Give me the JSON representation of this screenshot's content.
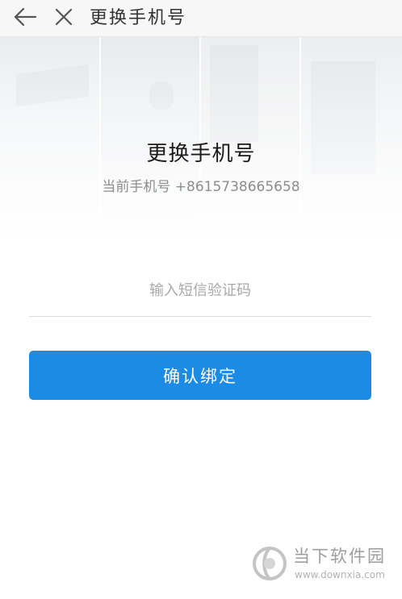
{
  "navbar": {
    "back_icon": "arrow-left-icon",
    "close_icon": "close-icon",
    "title": "更换手机号"
  },
  "main": {
    "title": "更换手机号",
    "current_phone_label": "当前手机号 +8615738665658",
    "code_input": {
      "placeholder": "输入短信验证码",
      "value": ""
    },
    "confirm_button_label": "确认绑定"
  },
  "watermark": {
    "text": "当下软件园",
    "url": "www.downxia.com"
  },
  "colors": {
    "primary": "#1c8be6",
    "navbar_bg": "#f7f7f7",
    "placeholder": "#a9a9a9",
    "watermark": "#9e9e9e"
  }
}
